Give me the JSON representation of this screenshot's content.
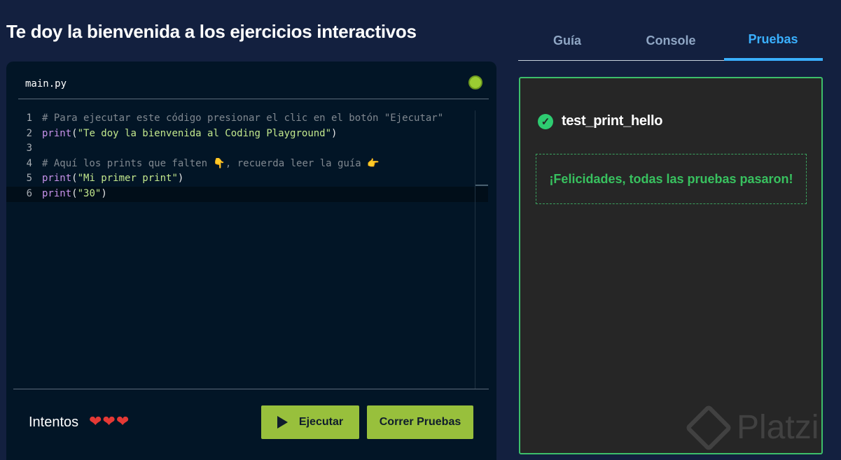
{
  "page": {
    "title": "Te doy la bienvenida a los ejercicios interactivos"
  },
  "editor": {
    "file_name": "main.py",
    "status_color": "#9acd32",
    "lines": [
      {
        "num": "1",
        "segments": [
          {
            "t": "# Para ejecutar este código presionar el clic en el botón \"Ejecutar\"",
            "c": "cm"
          }
        ]
      },
      {
        "num": "2",
        "segments": [
          {
            "t": "print",
            "c": "fn"
          },
          {
            "t": "(",
            "c": "pun"
          },
          {
            "t": "\"Te doy la bienvenida al Coding Playground\"",
            "c": "str"
          },
          {
            "t": ")",
            "c": "pun"
          }
        ]
      },
      {
        "num": "3",
        "segments": []
      },
      {
        "num": "4",
        "segments": [
          {
            "t": "# Aquí los prints que falten 👇, recuerda leer la guía 👉",
            "c": "cm"
          }
        ]
      },
      {
        "num": "5",
        "segments": [
          {
            "t": "print",
            "c": "fn"
          },
          {
            "t": "(",
            "c": "pun"
          },
          {
            "t": "\"Mi primer print\"",
            "c": "str"
          },
          {
            "t": ")",
            "c": "pun"
          }
        ]
      },
      {
        "num": "6",
        "segments": [
          {
            "t": "print",
            "c": "fn"
          },
          {
            "t": "(",
            "c": "pun"
          },
          {
            "t": "\"30\"",
            "c": "str"
          },
          {
            "t": ")",
            "c": "pun"
          }
        ]
      }
    ],
    "active_line": 6
  },
  "footer": {
    "attempts_label": "Intentos",
    "hearts": "❤❤❤",
    "run_label": "Ejecutar",
    "run_tests_label": "Correr Pruebas"
  },
  "tabs": [
    {
      "label": "Guía",
      "active": false
    },
    {
      "label": "Console",
      "active": false
    },
    {
      "label": "Pruebas",
      "active": true
    }
  ],
  "results": {
    "test_name": "test_print_hello",
    "test_status": "passed",
    "success_message": "¡Felicidades, todas las pruebas pasaron!"
  },
  "watermark": {
    "text": "Platzi"
  },
  "colors": {
    "accent_green": "#98c03c",
    "pass_green": "#38c15f",
    "tab_active": "#3ab0ff"
  }
}
